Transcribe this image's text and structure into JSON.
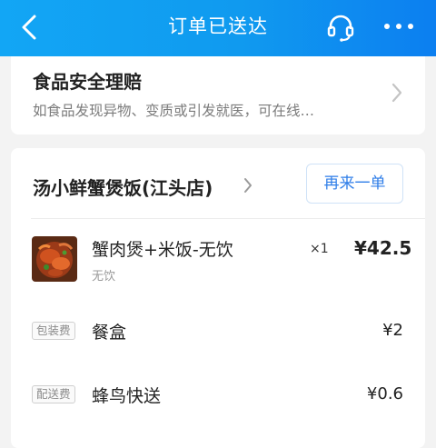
{
  "header": {
    "title": "订单已送达",
    "icons": {
      "back": "chevron-left-icon",
      "service": "headset-icon",
      "more": "more-dots-icon"
    }
  },
  "safety": {
    "title": "食品安全理赔",
    "description": "如食品发现异物、变质或引发就医，可在线…"
  },
  "order": {
    "shop_name": "汤小鲜蟹煲饭(江头店)",
    "reorder_label": "再来一单",
    "item": {
      "name": "蟹肉煲+米饭-无饮",
      "spec": "无饮",
      "quantity": "×1",
      "price": "¥42.5"
    },
    "fees": [
      {
        "tag": "包装费",
        "name": "餐盒",
        "price": "¥2"
      },
      {
        "tag": "配送费",
        "name": "蜂鸟快送",
        "price": "¥0.6"
      }
    ]
  },
  "colors": {
    "header_start": "#12a6f5",
    "header_end": "#0c7ff0",
    "accent_blue": "#2f7ee8",
    "background": "#f3f3f3"
  }
}
